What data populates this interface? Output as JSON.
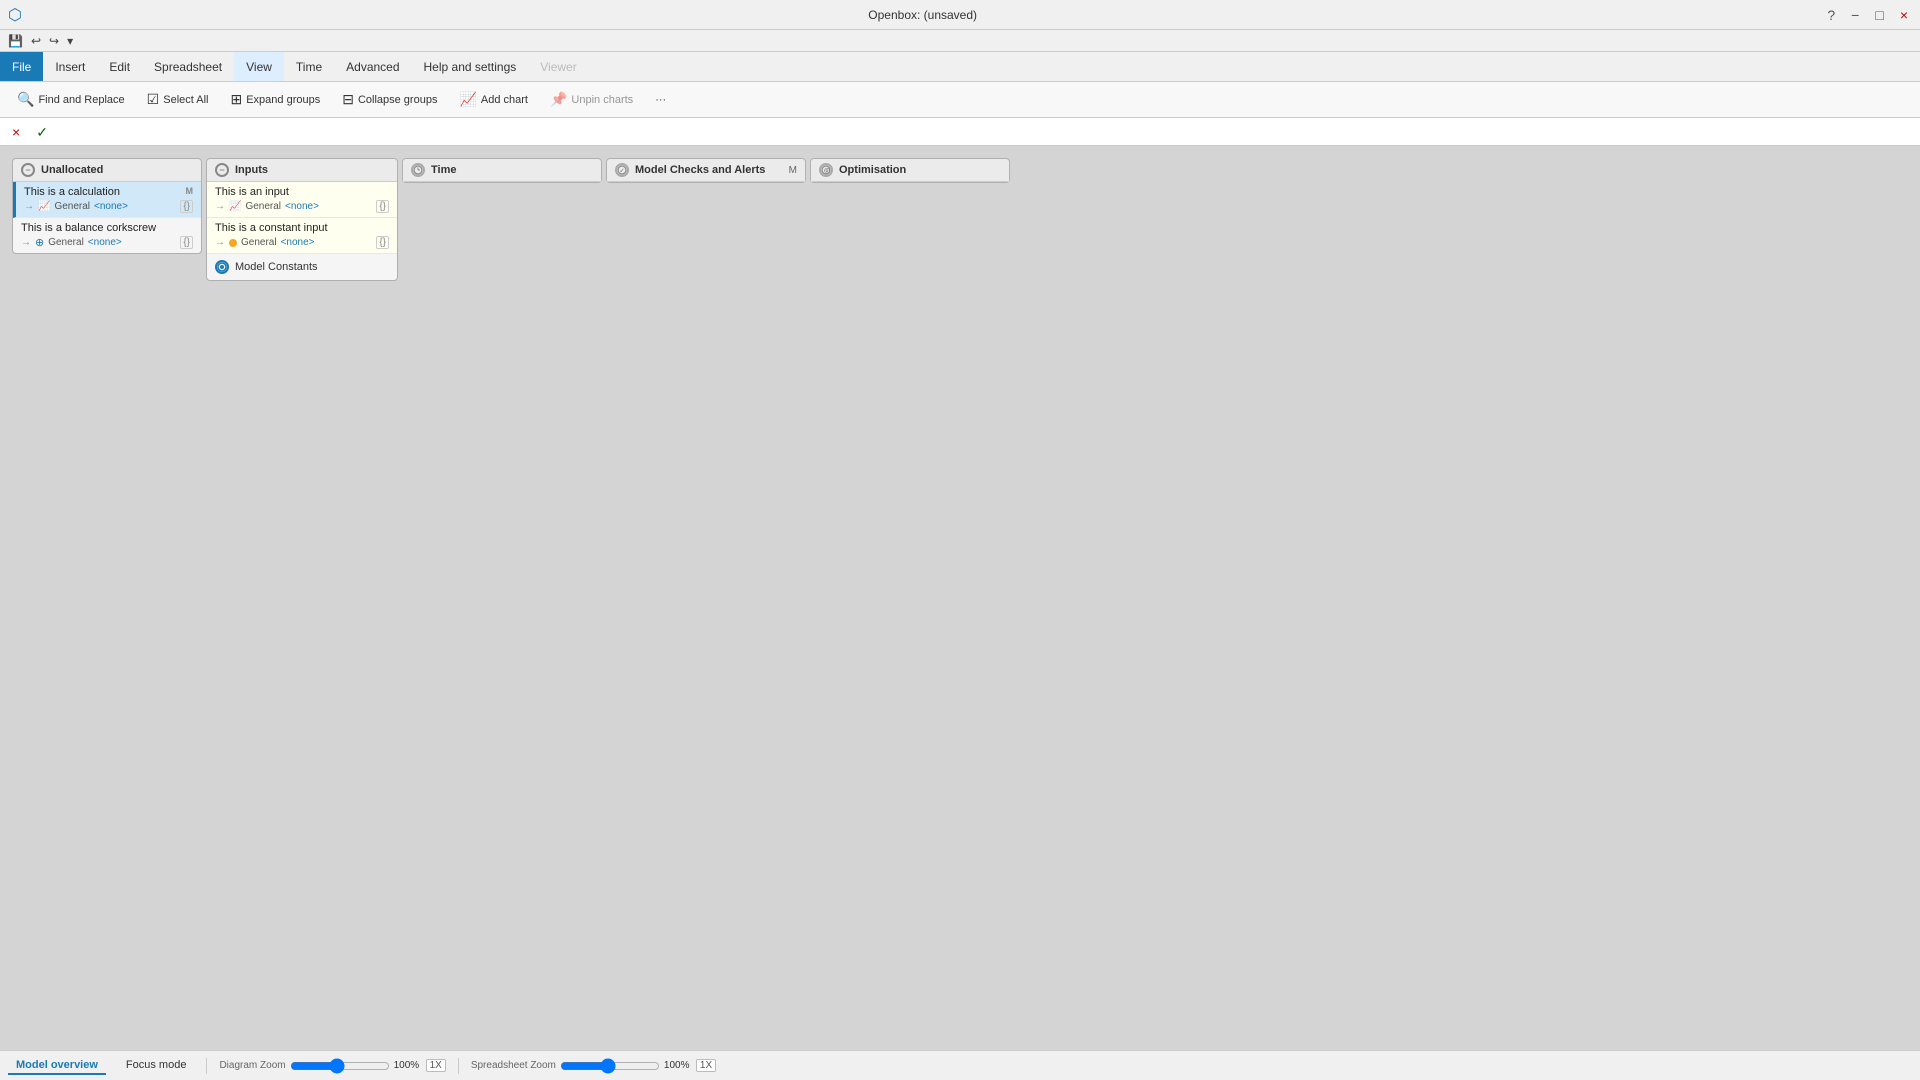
{
  "app": {
    "title": "Openbox:  (unsaved)",
    "window_controls": {
      "help": "?",
      "minimize": "−",
      "restore": "□",
      "close": "×"
    }
  },
  "quick_access": {
    "save_label": "💾",
    "undo_label": "↩",
    "redo_label": "↪",
    "dropdown_label": "▾"
  },
  "menu": {
    "items": [
      {
        "id": "file",
        "label": "File",
        "active": true
      },
      {
        "id": "insert",
        "label": "Insert",
        "active": false
      },
      {
        "id": "edit",
        "label": "Edit",
        "active": false
      },
      {
        "id": "spreadsheet",
        "label": "Spreadsheet",
        "active": false
      },
      {
        "id": "view",
        "label": "View",
        "active": false
      },
      {
        "id": "time",
        "label": "Time",
        "active": false
      },
      {
        "id": "advanced",
        "label": "Advanced",
        "active": false
      },
      {
        "id": "help",
        "label": "Help and settings",
        "active": false
      },
      {
        "id": "viewer",
        "label": "Viewer",
        "active": false,
        "disabled": true
      }
    ]
  },
  "ribbon": {
    "buttons": [
      {
        "id": "find-replace",
        "icon": "🔍",
        "label": "Find and Replace"
      },
      {
        "id": "select-all",
        "icon": "☑",
        "label": "Select All"
      },
      {
        "id": "expand-groups",
        "icon": "⊞",
        "label": "Expand groups"
      },
      {
        "id": "collapse-groups",
        "icon": "⊟",
        "label": "Collapse groups"
      },
      {
        "id": "add-chart",
        "icon": "📈",
        "label": "Add chart"
      },
      {
        "id": "unpin-charts",
        "icon": "📌",
        "label": "Unpin charts",
        "disabled": true
      },
      {
        "id": "more",
        "icon": "···",
        "label": ""
      }
    ]
  },
  "formula_bar": {
    "cancel_label": "×",
    "confirm_label": "✓"
  },
  "panels": {
    "unallocated": {
      "header_label": "Unallocated",
      "items": [
        {
          "id": "calc1",
          "name": "This is a calculation",
          "badge": "M",
          "arrow": "→",
          "type_icon": "📈",
          "category": "General",
          "value": "<none>",
          "format": "{}"
        },
        {
          "id": "balance1",
          "name": "This is a balance corkscrew",
          "badge": "",
          "arrow": "→",
          "type_icon": "⊕",
          "category": "General",
          "value": "<none>",
          "format": "{}"
        }
      ]
    },
    "inputs": {
      "header_label": "Inputs",
      "items": [
        {
          "id": "input1",
          "name": "This is an input",
          "badge": "",
          "arrow": "→",
          "type_icon": "📈",
          "category": "General",
          "value": "<none>",
          "format": "{}",
          "dot_color": ""
        },
        {
          "id": "const1",
          "name": "This is a constant input",
          "badge": "",
          "arrow": "→",
          "type_icon": "",
          "category": "General",
          "value": "<none>",
          "format": "{}",
          "dot_color": "orange"
        }
      ],
      "model_constants_label": "Model Constants"
    },
    "time": {
      "header_label": "Time",
      "items": []
    },
    "model_checks": {
      "header_label": "Model Checks and Alerts",
      "badge": "M",
      "items": []
    },
    "optimisation": {
      "header_label": "Optimisation",
      "items": []
    }
  },
  "status_bar": {
    "tabs": [
      {
        "id": "model-overview",
        "label": "Model overview",
        "active": true
      },
      {
        "id": "focus-mode",
        "label": "Focus mode",
        "active": false
      }
    ],
    "diagram_zoom": {
      "label": "Diagram Zoom",
      "value": 100,
      "unit": "%",
      "reset": "1X"
    },
    "spreadsheet_zoom": {
      "label": "Spreadsheet Zoom",
      "value": 100,
      "unit": "%",
      "reset": "1X"
    }
  }
}
